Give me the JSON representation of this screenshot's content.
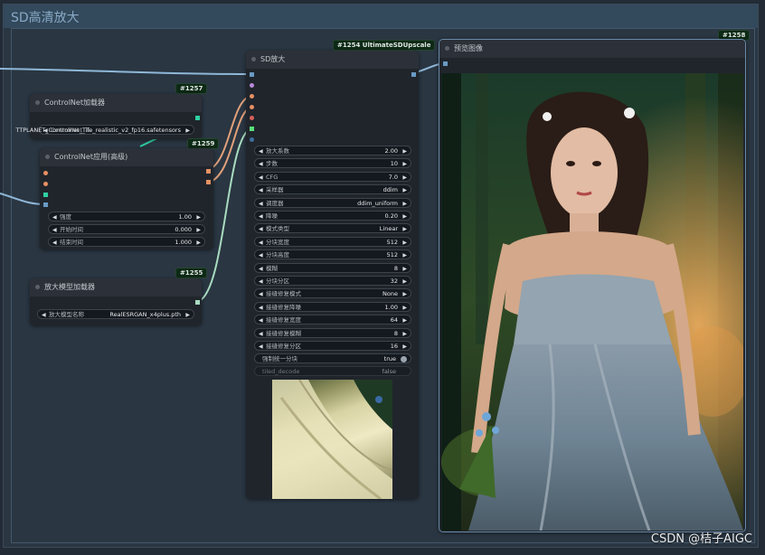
{
  "group": {
    "title": "SD高清放大"
  },
  "nodes": {
    "cn_loader": {
      "id": "#1257",
      "title": "ControlNet加载器",
      "widget_label": "ControlNet_Ti",
      "widget_value": "TTPLANET_Controlnet_Tile_realistic_v2_fp16.safetensors"
    },
    "cn_apply": {
      "id": "#1259",
      "title": "ControlNet应用(高级)",
      "widgets": [
        {
          "label": "强度",
          "value": "1.00"
        },
        {
          "label": "开始时间",
          "value": "0.000"
        },
        {
          "label": "结束时间",
          "value": "1.000"
        }
      ]
    },
    "upscale_loader": {
      "id": "#1255",
      "title": "放大模型加载器",
      "widget_label": "放大模型名称",
      "widget_value": "RealESRGAN_x4plus.pth"
    },
    "sd_upscale": {
      "id": "#1254 UltimateSDUpscale",
      "title": "SD放大",
      "widgets": [
        {
          "label": "放大系数",
          "value": "2.00"
        },
        {
          "label": "步数",
          "value": "10"
        },
        {
          "label": "CFG",
          "value": "7.0"
        },
        {
          "label": "采样器",
          "value": "ddim"
        },
        {
          "label": "调度器",
          "value": "ddim_uniform"
        },
        {
          "label": "降噪",
          "value": "0.20"
        },
        {
          "label": "模式类型",
          "value": "Linear"
        },
        {
          "label": "分块宽度",
          "value": "512"
        },
        {
          "label": "分块高度",
          "value": "512"
        },
        {
          "label": "模糊",
          "value": "8"
        },
        {
          "label": "分块分区",
          "value": "32"
        },
        {
          "label": "接缝修复模式",
          "value": "None"
        },
        {
          "label": "接缝修复降噪",
          "value": "1.00"
        },
        {
          "label": "接缝修复宽度",
          "value": "64"
        },
        {
          "label": "接缝修复模糊",
          "value": "8"
        },
        {
          "label": "接缝修复分区",
          "value": "16"
        }
      ],
      "toggle": {
        "label": "强制统一分块",
        "value": "true"
      },
      "disabled_widget": {
        "label": "tiled_decode",
        "value": "false"
      }
    },
    "preview": {
      "id": "#1258",
      "title": "预览图像"
    }
  },
  "watermark": "CSDN @桔子AIGC",
  "colors": {
    "wire_image": "#8fb8d8",
    "wire_conditioning": "#e0a07a",
    "wire_controlnet": "#2fd0a0",
    "wire_upscale": "#a8dcc0",
    "slot_blue": "#6a9ac4",
    "slot_purple": "#b98ad8",
    "slot_orange": "#e79063",
    "slot_red": "#d8605a",
    "slot_green": "#5ae07a"
  }
}
